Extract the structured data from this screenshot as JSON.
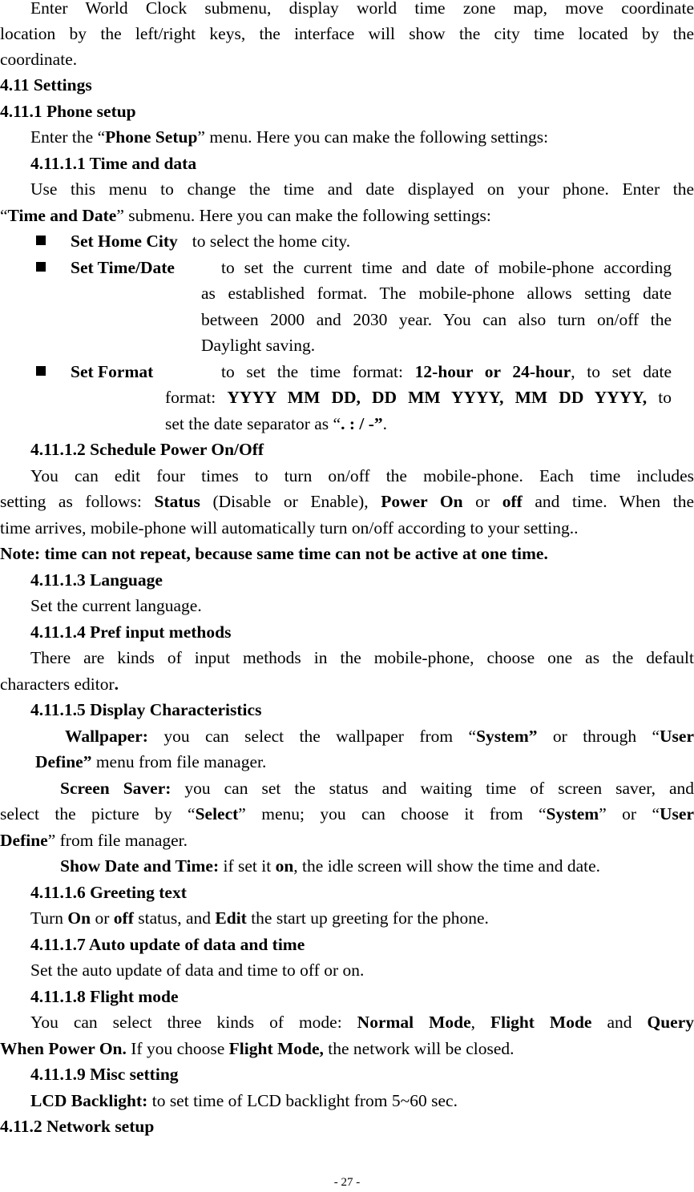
{
  "intro": {
    "line1": "Enter World Clock submenu, display world time zone map, move coordinate",
    "line2": "location by the left/right keys, the interface will show the city time located by the",
    "line3": "coordinate."
  },
  "headings": {
    "settings": "4.11 Settings",
    "phone_setup": "4.11.1 Phone setup",
    "time_and_data": "4.11.1.1 Time and data",
    "schedule_power": "4.11.1.2 Schedule Power On/Off",
    "language": "4.11.1.3 Language",
    "input_methods": "4.11.1.4 Pref input methods",
    "display": "4.11.1.5 Display Characteristics",
    "greeting": "4.11.1.6 Greeting text",
    "auto_update": "4.11.1.7 Auto update of data and time",
    "flight_mode": "4.11.1.8 Flight mode",
    "misc": "4.11.1.9 Misc setting",
    "network_setup": "4.11.2 Network setup"
  },
  "phone_setup": {
    "pre": "Enter the “",
    "bold": "Phone Setup",
    "post": "” menu. Here you can make the following settings:"
  },
  "time_and_data": {
    "line1": "Use this menu to change the time and date displayed on your phone. Enter the",
    "line2_q1": "“",
    "line2_bold": "Time and Date",
    "line2_rest": "” submenu. Here you can make the following settings:"
  },
  "bullets": [
    {
      "label": "Set Home City",
      "lines": [
        "to select the home city."
      ]
    },
    {
      "label": "Set Time/Date",
      "lines": [
        "to set the current time and date of mobile-phone according",
        "as established format. The mobile-phone allows setting date",
        "between 2000 and 2030 year. You can also turn on/off the",
        "Daylight saving."
      ]
    },
    {
      "label": "Set Format",
      "line1_pre": "to set the time format: ",
      "line1_bold": "12-hour or 24-hour",
      "line1_post": ", to set date",
      "line2_pre": "format: ",
      "line2_bold": "YYYY MM DD, DD MM YYYY, MM DD YYYY,",
      "line2_post": " to",
      "line3_pre": "set the date separator as “",
      "line3_bold": ". : / -”",
      "line3_post": "."
    }
  ],
  "schedule_power": {
    "line1": "You can edit four times to turn on/off the mobile-phone. Each time includes",
    "line2_a": "setting as follows: ",
    "line2_b": "Status",
    "line2_c": " (Disable or Enable), ",
    "line2_d": "Power On",
    "line2_e": " or ",
    "line2_f": "off",
    "line2_g": " and time. When the",
    "line3": "time arrives, mobile-phone will automatically turn on/off according to your setting..",
    "note": "Note: time can not repeat, because same time can not be active at one time."
  },
  "language": {
    "text": "Set the current language."
  },
  "input_methods": {
    "line1": "There are kinds of input methods in the mobile-phone, choose one as the default",
    "line2": "characters editor",
    "line2_dot": "."
  },
  "display": {
    "wallpaper_label": "Wallpaper:",
    "wallpaper_a": " you can select the wallpaper from “",
    "wallpaper_b": "System”",
    "wallpaper_c": " or through “",
    "wallpaper_d": "User",
    "wallpaper_e": "Define”",
    "wallpaper_f": " menu from file manager.",
    "saver_label": "Screen Saver:",
    "saver_a": " you can set the status and waiting time of screen saver, and",
    "saver_b": "select the picture by “",
    "saver_c": "Select",
    "saver_d": "” menu; you can choose it from “",
    "saver_e": "System",
    "saver_f": "” or “",
    "saver_g": "User",
    "saver_h": "Define",
    "saver_i": "” from file manager.",
    "show_label": "Show Date and Time:",
    "show_a": " if set it ",
    "show_b": "on",
    "show_c": ", the idle screen will show the time and date."
  },
  "greeting": {
    "a": "Turn ",
    "b": "On",
    "c": " or ",
    "d": "off",
    "e": " status, and ",
    "f": "Edit",
    "g": " the start up greeting for the phone."
  },
  "auto_update": {
    "text": "Set the auto update of data and time to off or on."
  },
  "flight_mode": {
    "line1_a": "You can select three kinds of mode: ",
    "line1_b": "Normal Mode",
    "line1_c": ", ",
    "line1_d": "Flight Mode",
    "line1_e": " and ",
    "line1_f": "Query",
    "line2_a": "When Power On.",
    "line2_b": " If you choose ",
    "line2_c": "Flight Mode,",
    "line2_d": " the network will be closed."
  },
  "misc": {
    "label": "LCD Backlight:",
    "text": " to set time of LCD backlight from 5~60 sec."
  },
  "footer": {
    "page_number": "- 27 -"
  }
}
